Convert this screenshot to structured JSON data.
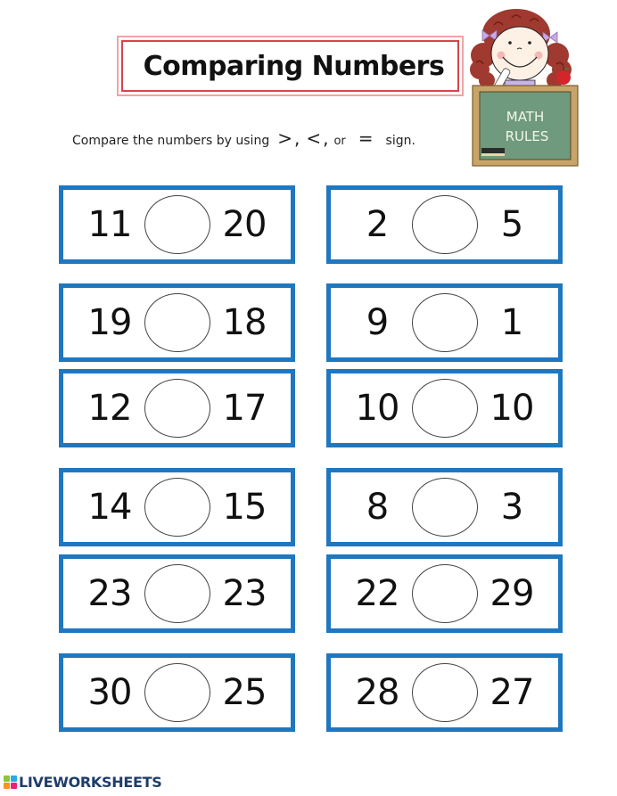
{
  "title": "Comparing Numbers",
  "instructions": {
    "text": "Compare the numbers by using",
    "symbols": [
      ">",
      "<",
      "="
    ],
    "sep1": ",",
    "sep2": ",",
    "or": "or",
    "tail": "sign."
  },
  "illustration": {
    "chalkboard_line1": "MATH",
    "chalkboard_line2": "RULES"
  },
  "comparisons": [
    {
      "left": "11",
      "right": "20"
    },
    {
      "left": "2",
      "right": "5"
    },
    {
      "left": "19",
      "right": "18"
    },
    {
      "left": "9",
      "right": "1"
    },
    {
      "left": "12",
      "right": "17"
    },
    {
      "left": "10",
      "right": "10"
    },
    {
      "left": "14",
      "right": "15"
    },
    {
      "left": "8",
      "right": "3"
    },
    {
      "left": "23",
      "right": "23"
    },
    {
      "left": "22",
      "right": "29"
    },
    {
      "left": "30",
      "right": "25"
    },
    {
      "left": "28",
      "right": "27"
    }
  ],
  "footer": {
    "brand": "LIVEWORKSHEETS",
    "logo_colors": [
      "#8cc63f",
      "#29abe2",
      "#f7931e",
      "#ec1e79"
    ]
  },
  "colors": {
    "card_border": "#1f77c0",
    "title_border": "#d9434c"
  }
}
